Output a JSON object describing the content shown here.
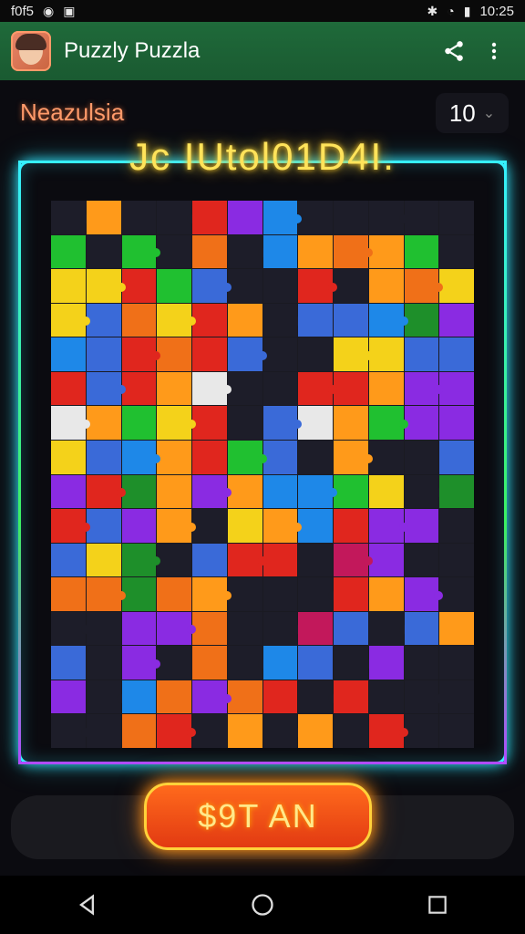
{
  "status_bar": {
    "left_text": "f0f5",
    "time": "10:25"
  },
  "app_bar": {
    "title": "Puzzly Puzzla",
    "share_icon": "share-icon",
    "menu_icon": "more-vert-icon"
  },
  "level": {
    "label": "Neazulsia",
    "value": "10"
  },
  "board": {
    "title": "Jc IUtol01D4I.",
    "palette": [
      "#1e8f2a",
      "#f4d21a",
      "#f07018",
      "#e0261e",
      "#1e88e8",
      "#8a2be2",
      "#e8e8e8",
      "#20c030",
      "#c2185b",
      "#2a2a3a",
      "#ff9a1a",
      "#3a6ad8"
    ],
    "rows": [
      "9a9935499999",
      "7979294a2a79",
      "1137b9939a21",
      "1b213a9bb4c5",
      "4b323b9911bb",
      "3b3a69933a55",
      "6a7139b6a755",
      "1b4a37b9a99b",
      "53ca5a44719c",
      "3b5a91a43559",
      "b1c9b3398599",
      "22c2a9993a59",
      "99552998b9ba",
      "b959294b9599",
      "594252393999",
      "99239a9a9399"
    ]
  },
  "start_button": {
    "label": "$9T AN"
  },
  "nav": {
    "back_icon": "back-icon",
    "home_icon": "home-icon",
    "recents_icon": "recents-icon"
  }
}
